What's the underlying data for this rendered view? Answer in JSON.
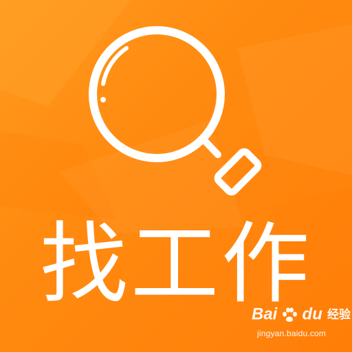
{
  "title": "找工作",
  "icon": "magnifying-glass-icon",
  "colors": {
    "background_start": "#ff9a1e",
    "background_end": "#ff7f0a",
    "foreground": "#ffffff"
  },
  "watermark": {
    "brand_bai": "Bai",
    "brand_du": "du",
    "brand_suffix": "经验",
    "url": "jingyan.baidu.com"
  }
}
